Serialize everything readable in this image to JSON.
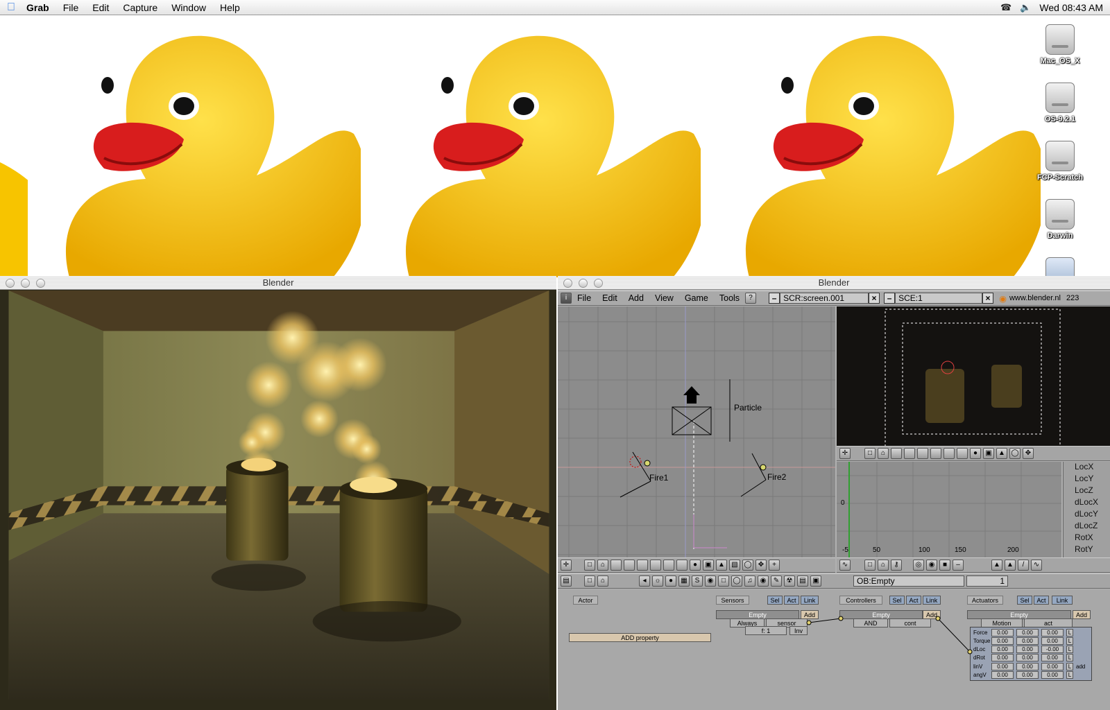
{
  "menubar": {
    "app_name": "Grab",
    "items": [
      "File",
      "Edit",
      "Capture",
      "Window",
      "Help"
    ],
    "clock": "Wed 08:43 AM",
    "phone_icon": "phone-icon",
    "volume_icon": "volume-icon"
  },
  "desktop": {
    "drives": [
      {
        "label": "Mac_OS_X"
      },
      {
        "label": "OS-9.2.1"
      },
      {
        "label": "FCP-Scratch"
      },
      {
        "label": "Darwin"
      }
    ]
  },
  "render_window": {
    "title": "Blender"
  },
  "blender_window": {
    "title": "Blender",
    "menus": [
      "File",
      "Edit",
      "Add",
      "View",
      "Game",
      "Tools"
    ],
    "screen_field": "SCR:screen.001",
    "scene_field": "SCE:1",
    "url": "www.blender.nl",
    "version": "223",
    "viewport_labels": {
      "particle": "Particle",
      "fire1": "Fire1",
      "fire2": "Fire2"
    },
    "ipo_channels": [
      "LocX",
      "LocY",
      "LocZ",
      "dLocX",
      "dLocY",
      "dLocZ",
      "RotX",
      "RotY"
    ],
    "ipo_ticks_x": [
      "-5",
      "50",
      "100",
      "150",
      "200"
    ],
    "ipo_tick_y": "0",
    "ob_field": "OB:Empty",
    "ob_number": "1",
    "logic": {
      "actor_button": "Actor",
      "add_property": "ADD property",
      "sensors_label": "Sensors",
      "controllers_label": "Controllers",
      "actuators_label": "Actuators",
      "sel": "Sel",
      "act": "Act",
      "link": "Link",
      "add": "Add",
      "empty": "Empty",
      "sensor_type": "Always",
      "sensor_name": "sensor",
      "sensor_freq": "f: 1",
      "sensor_inv": "Inv",
      "controller_type": "AND",
      "controller_name": "cont",
      "actuator_type": "Motion",
      "actuator_name": "act",
      "motion_rows": [
        {
          "label": "Force",
          "values": [
            "0.00",
            "0.00",
            "0.00"
          ],
          "flag": "L"
        },
        {
          "label": "Torque",
          "values": [
            "0.00",
            "0.00",
            "0.00"
          ],
          "flag": "L"
        },
        {
          "label": "dLoc",
          "values": [
            "0.00",
            "0.00",
            "-0.00"
          ],
          "flag": "L"
        },
        {
          "label": "dRot",
          "values": [
            "0.00",
            "0.00",
            "0.00"
          ],
          "flag": "L"
        },
        {
          "label": "linV",
          "values": [
            "0.00",
            "0.00",
            "0.00"
          ],
          "flag": "L",
          "extra": "add"
        },
        {
          "label": "angV",
          "values": [
            "0.00",
            "0.00",
            "0.00"
          ],
          "flag": "L"
        }
      ]
    }
  }
}
